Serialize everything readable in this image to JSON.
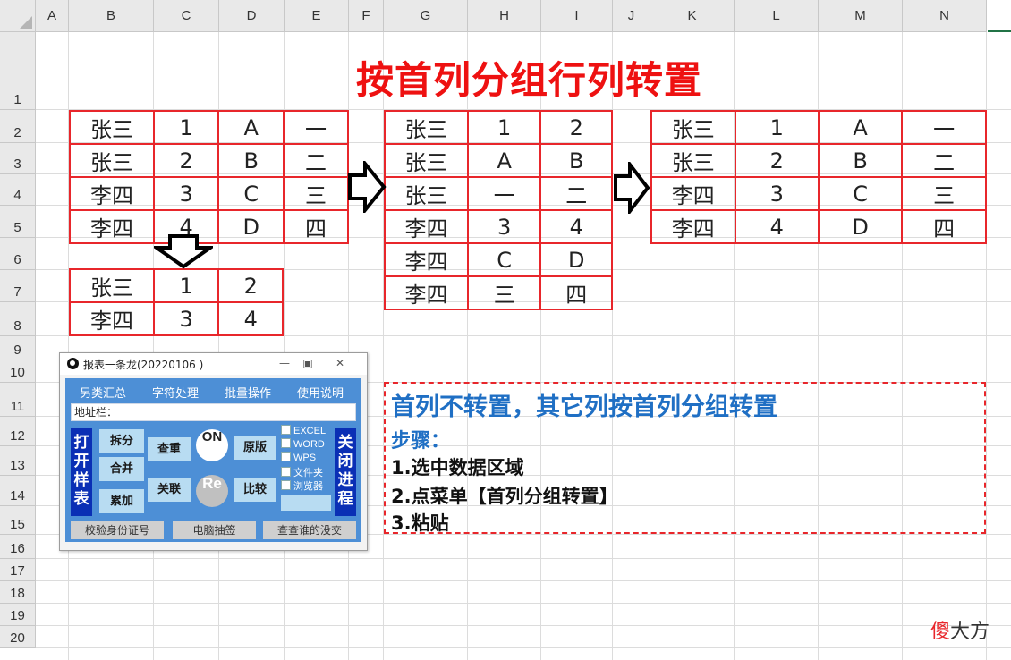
{
  "sheet": {
    "columns": [
      "A",
      "B",
      "C",
      "D",
      "E",
      "F",
      "G",
      "H",
      "I",
      "J",
      "K",
      "L",
      "M",
      "N"
    ],
    "rows": [
      "1",
      "2",
      "3",
      "4",
      "5",
      "6",
      "7",
      "8",
      "9",
      "10",
      "11",
      "12",
      "13",
      "14",
      "15",
      "16",
      "17",
      "18",
      "19",
      "20"
    ]
  },
  "title": "按首列分组行列转置",
  "table_source": [
    [
      "张三",
      "1",
      "A",
      "一"
    ],
    [
      "张三",
      "2",
      "B",
      "二"
    ],
    [
      "李四",
      "3",
      "C",
      "三"
    ],
    [
      "李四",
      "4",
      "D",
      "四"
    ]
  ],
  "table_grouped": [
    [
      "张三",
      "1",
      "2"
    ],
    [
      "李四",
      "3",
      "4"
    ]
  ],
  "table_middle": [
    [
      "张三",
      "1",
      "2"
    ],
    [
      "张三",
      "A",
      "B"
    ],
    [
      "张三",
      "一",
      "二"
    ],
    [
      "李四",
      "3",
      "4"
    ],
    [
      "李四",
      "C",
      "D"
    ],
    [
      "李四",
      "三",
      "四"
    ]
  ],
  "table_result": [
    [
      "张三",
      "1",
      "A",
      "一"
    ],
    [
      "张三",
      "2",
      "B",
      "二"
    ],
    [
      "李四",
      "3",
      "C",
      "三"
    ],
    [
      "李四",
      "4",
      "D",
      "四"
    ]
  ],
  "note": {
    "line1": "首列不转置，其它列按首列分组转置",
    "line2": "步骤：",
    "line3": "1.选中数据区域",
    "line4": "2.点菜单【首列分组转置】",
    "line5": "3.粘贴"
  },
  "tool_window": {
    "title": "报表一条龙(20220106 )",
    "menus": [
      "另类汇总",
      "字符处理",
      "批量操作",
      "使用说明"
    ],
    "address_label": "地址栏：",
    "left_side_button": "打开样表",
    "right_side_button": "关闭进程",
    "buttons": {
      "split": "拆分",
      "merge": "合并",
      "accumulate": "累加",
      "check_dup": "查重",
      "relate": "关联",
      "on": "ON",
      "re": "Re",
      "original": "原版",
      "compare": "比较"
    },
    "checkboxes": [
      "EXCEL",
      "WORD",
      "WPS",
      "文件夹",
      "浏览器"
    ],
    "bottom_buttons": [
      "校验身份证号",
      "电脑抽签",
      "查查谁的没交"
    ]
  },
  "watermark": {
    "red": "傻",
    "rest": "大方"
  }
}
